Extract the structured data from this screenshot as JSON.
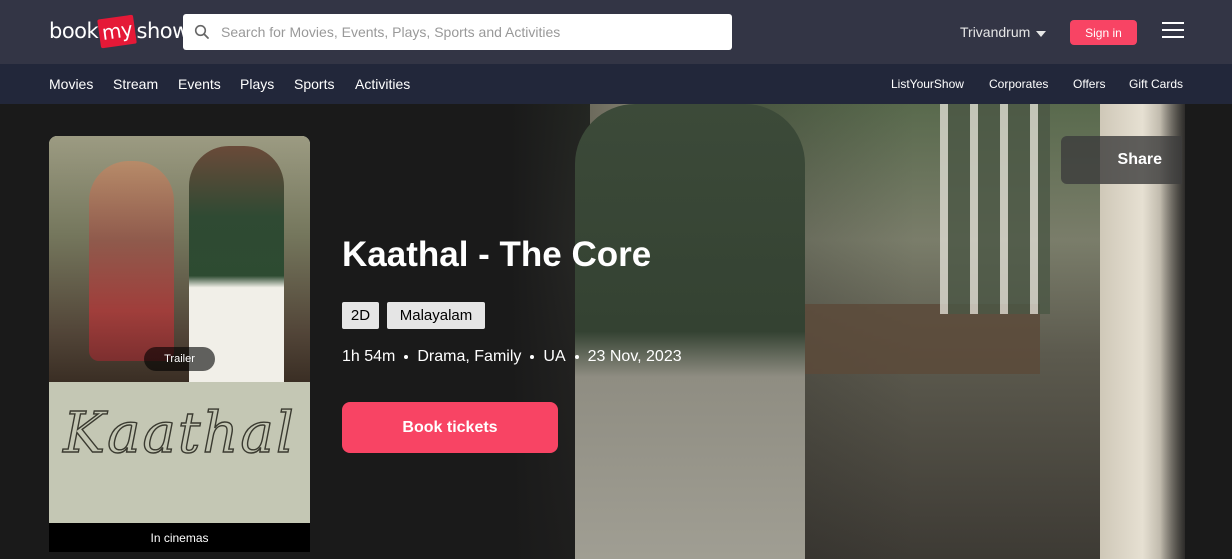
{
  "header": {
    "logo_left": "book",
    "logo_mid": "my",
    "logo_right": "show",
    "search_placeholder": "Search for Movies, Events, Plays, Sports and Activities",
    "city": "Trivandrum",
    "signin": "Sign in",
    "icons": {
      "search": "search-icon",
      "city_caret": "caret-down-icon",
      "menu": "hamburger-menu-icon"
    }
  },
  "subnav": {
    "left": [
      "Movies",
      "Stream",
      "Events",
      "Plays",
      "Sports",
      "Activities"
    ],
    "right": [
      "ListYourShow",
      "Corporates",
      "Offers",
      "Gift Cards"
    ]
  },
  "movie": {
    "title": "Kaathal - The Core",
    "formats": [
      "2D",
      "Malayalam"
    ],
    "duration": "1h 54m",
    "genres": "Drama, Family",
    "rating": "UA",
    "release_date": "23 Nov, 2023",
    "book_label": "Book tickets",
    "share_label": "Share",
    "poster": {
      "logo_text": "Kaathal",
      "trailer_label": "Trailer",
      "status": "In cinemas"
    }
  },
  "colors": {
    "accent": "#f84464",
    "header_bg": "#333545",
    "subnav_bg": "#22273a",
    "hero_bg": "#1a1a1a"
  }
}
